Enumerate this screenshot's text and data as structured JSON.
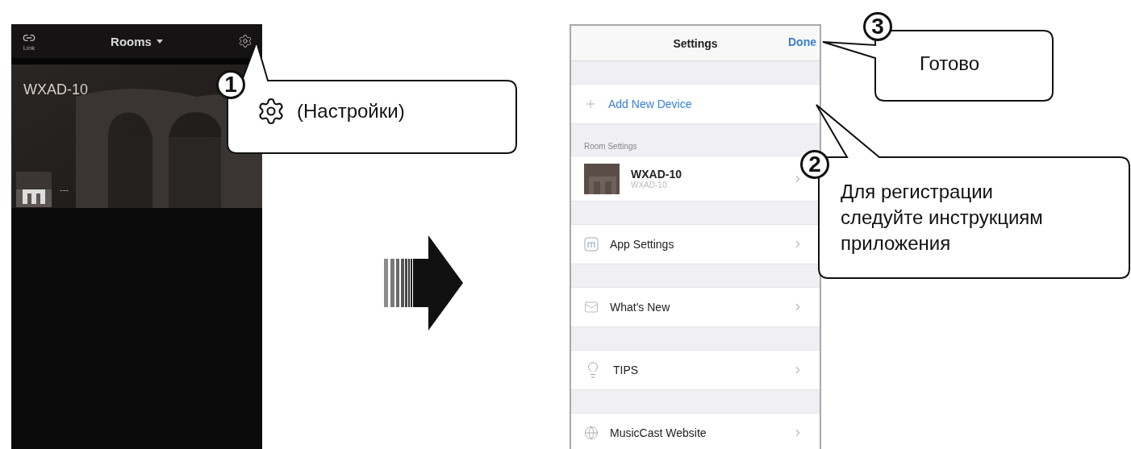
{
  "left_screen": {
    "link_label": "Link",
    "title": "Rooms",
    "room_name": "WXAD-10",
    "now_playing": "---"
  },
  "right_screen": {
    "title": "Settings",
    "done": "Done",
    "groups": [
      {
        "items": [
          {
            "kind": "add",
            "title": "Add New Device"
          }
        ]
      },
      {
        "label": "Room Settings",
        "items": [
          {
            "kind": "room",
            "title": "WXAD-10",
            "subtitle": "WXAD-10"
          }
        ]
      },
      {
        "items": [
          {
            "kind": "app",
            "title": "App Settings"
          }
        ]
      },
      {
        "items": [
          {
            "kind": "news",
            "title": "What's New"
          }
        ]
      },
      {
        "items": [
          {
            "kind": "tips",
            "title": "TIPS"
          }
        ]
      },
      {
        "items": [
          {
            "kind": "web",
            "title": "MusicCast Website"
          }
        ]
      }
    ]
  },
  "callouts": [
    {
      "number": "1",
      "kind": "gear",
      "lines": [
        "(Настройки)"
      ]
    },
    {
      "number": "3",
      "kind": "text",
      "lines": [
        "Готово"
      ]
    },
    {
      "number": "2",
      "kind": "text",
      "lines": [
        "Для регистрации",
        "следуйте инструкциям",
        "приложения"
      ]
    }
  ]
}
